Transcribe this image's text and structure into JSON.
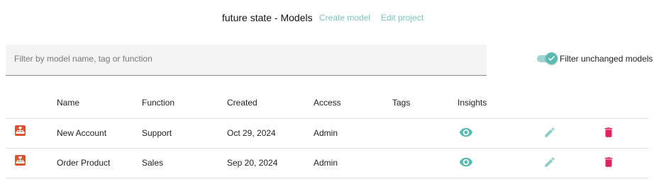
{
  "header": {
    "title": "future state - Models",
    "create_model_link": "Create model",
    "edit_project_link": "Edit project"
  },
  "filter": {
    "placeholder": "Filter by model name, tag or function",
    "value": ""
  },
  "toggle": {
    "label": "Filter unchanged models",
    "checked": true
  },
  "table": {
    "columns": {
      "name": "Name",
      "function": "Function",
      "created": "Created",
      "access": "Access",
      "tags": "Tags",
      "insights": "Insights"
    },
    "rows": [
      {
        "name": "New Account",
        "function": "Support",
        "created": "Oct 29, 2024",
        "access": "Admin",
        "tags": ""
      },
      {
        "name": "Order Product",
        "function": "Sales",
        "created": "Sep 20, 2024",
        "access": "Admin",
        "tags": ""
      }
    ]
  },
  "icons": {
    "model": "org-chart-icon",
    "insights": "eye-icon",
    "edit": "pencil-icon",
    "delete": "trash-icon",
    "toggle": "check-icon"
  },
  "colors": {
    "accent": "#5bbbb2",
    "accent_light": "#9fd4cf",
    "link": "#7cc4bd",
    "model_icon": "#d9532f",
    "delete": "#e0245e"
  }
}
